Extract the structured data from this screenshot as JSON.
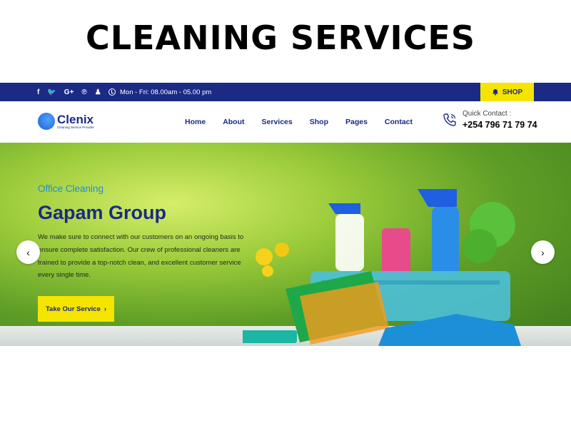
{
  "page_heading": "CLEANING SERVICES",
  "topbar": {
    "social_icons": [
      {
        "name": "facebook-icon",
        "glyph": "f"
      },
      {
        "name": "twitter-icon",
        "glyph": "🐦"
      },
      {
        "name": "google-plus-icon",
        "glyph": "G+"
      },
      {
        "name": "pinterest-icon",
        "glyph": "℗"
      },
      {
        "name": "snapchat-icon",
        "glyph": "♟"
      }
    ],
    "hours": "Mon - Fri: 08.00am - 05.00 pm",
    "shop_label": "SHOP"
  },
  "header": {
    "logo_name": "Clenix",
    "logo_tagline": "Cleaning Service Provider",
    "nav": [
      "Home",
      "About",
      "Services",
      "Shop",
      "Pages",
      "Contact"
    ],
    "quick_contact_label": "Quick Contact :",
    "quick_contact_phone": "+254 796 71 79 74"
  },
  "hero": {
    "category": "Office Cleaning",
    "title": "Gapam Group",
    "description": "We make sure to connect with our customers on an ongoing basis to ensure complete satisfaction. Our crew of professional cleaners are trained to provide a top-notch clean, and excellent customer service every single time.",
    "cta_label": "Take Our Service",
    "cta_icon": "›",
    "prev_icon": "‹",
    "next_icon": "›"
  },
  "colors": {
    "primary": "#1b2a85",
    "accent": "#f5e400",
    "link_blue": "#1f8ed8"
  }
}
